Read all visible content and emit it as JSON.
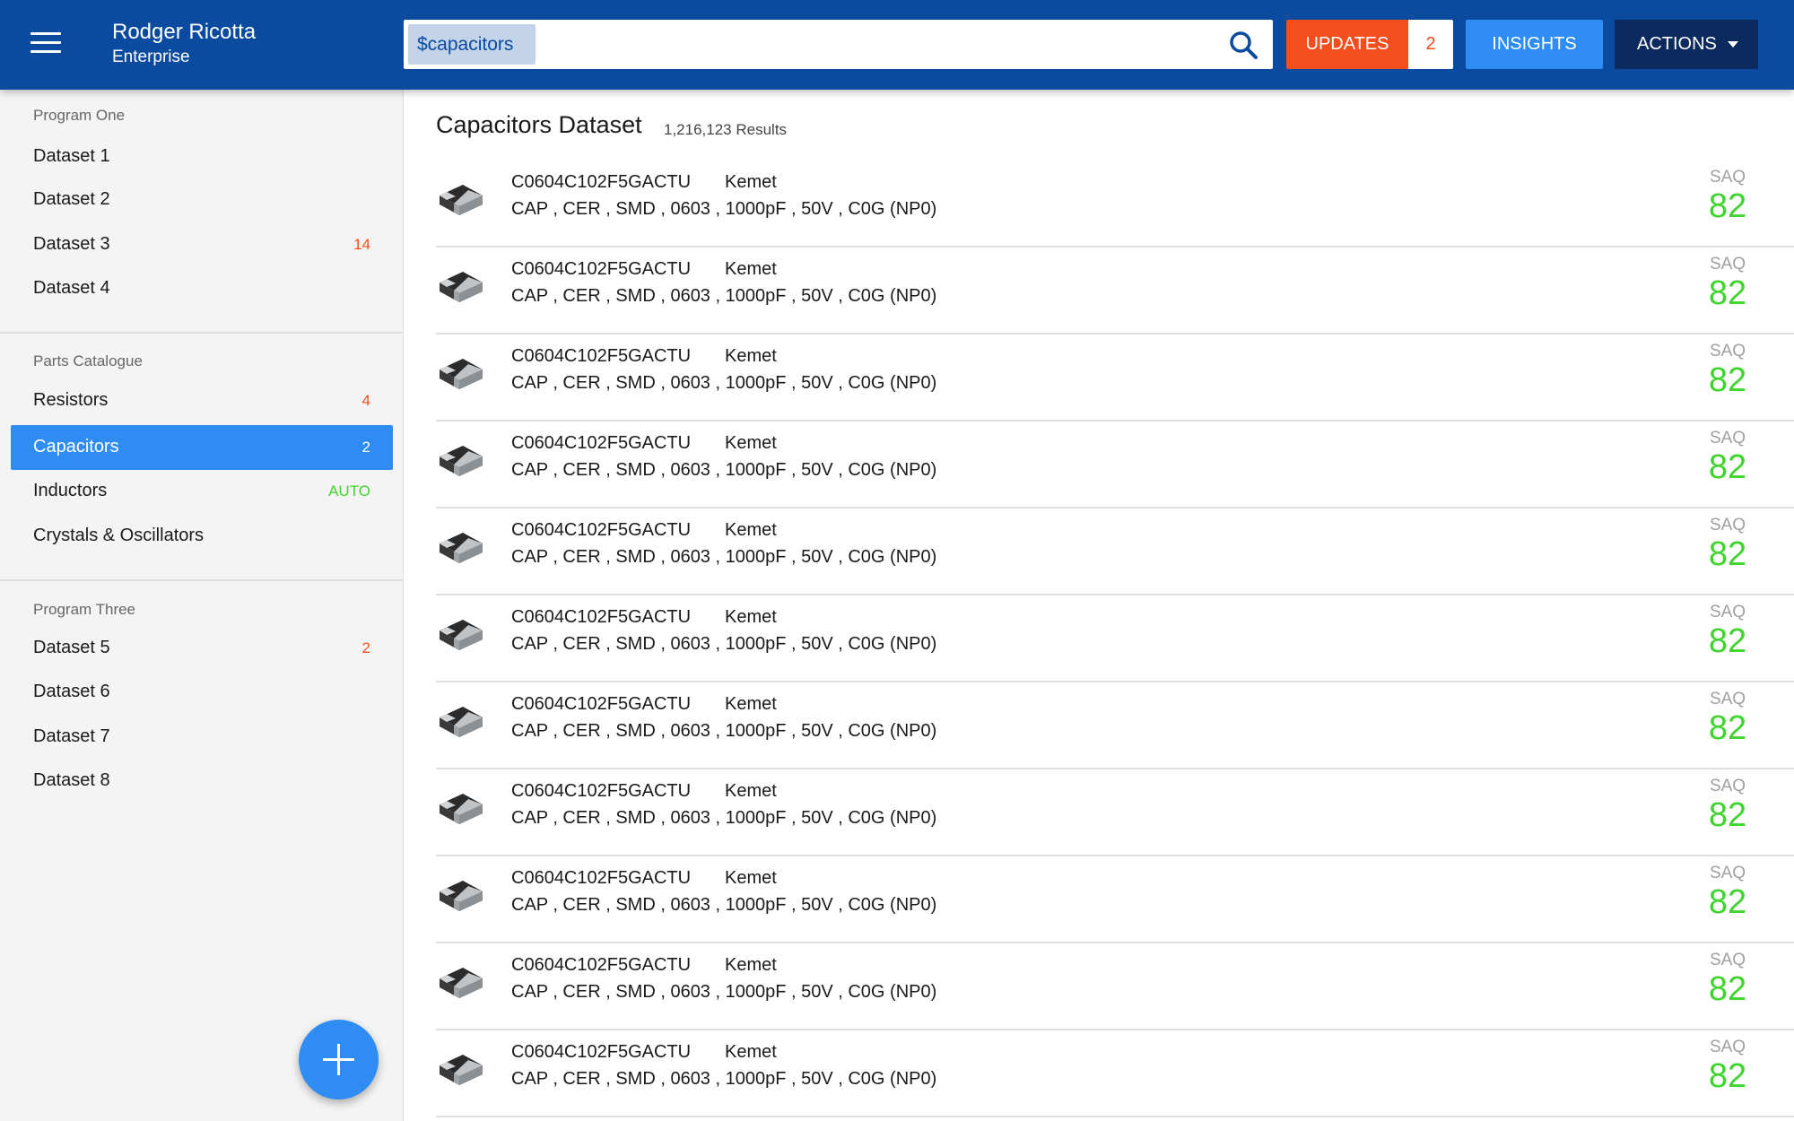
{
  "header": {
    "user_name": "Rodger Ricotta",
    "user_org": "Enterprise",
    "search": {
      "chip": "$capacitors",
      "value": "",
      "placeholder": ""
    },
    "updates_label": "UPDATES",
    "updates_count": "2",
    "insights_label": "INSIGHTS",
    "actions_label": "ACTIONS",
    "icons": {
      "menu": "hamburger-menu-icon",
      "search": "search-icon",
      "actions": "caret-down-icon"
    }
  },
  "sidebar": {
    "sections": [
      {
        "title": "Program  One",
        "items": [
          {
            "label": "Dataset 1",
            "badge": ""
          },
          {
            "label": "Dataset 2",
            "badge": ""
          },
          {
            "label": "Dataset 3",
            "badge": "14"
          },
          {
            "label": "Dataset 4",
            "badge": ""
          }
        ]
      },
      {
        "title": "Parts Catalogue",
        "items": [
          {
            "label": "Resistors",
            "badge": "4"
          },
          {
            "label": "Capacitors",
            "badge": "2",
            "active": true
          },
          {
            "label": "Inductors",
            "badge": "AUTO"
          },
          {
            "label": "Crystals & Oscillators",
            "badge": ""
          }
        ]
      },
      {
        "title": "Program  Three",
        "items": [
          {
            "label": "Dataset 5",
            "badge": "2"
          },
          {
            "label": "Dataset 6",
            "badge": ""
          },
          {
            "label": "Dataset 7",
            "badge": ""
          },
          {
            "label": "Dataset 8",
            "badge": ""
          }
        ]
      }
    ],
    "fab_icon": "plus-icon"
  },
  "main": {
    "title": "Capacitors Dataset",
    "result_count": "1,216,123 Results",
    "rows": [
      {
        "part": "C0604C102F5GACTU",
        "maker": "Kemet",
        "specs": "CAP ,  CER ,  SMD ,  0603 ,  1000pF ,  50V ,  C0G (NP0)",
        "saq_label": "SAQ",
        "saq": "82"
      },
      {
        "part": "C0604C102F5GACTU",
        "maker": "Kemet",
        "specs": "CAP ,  CER ,  SMD ,  0603 ,  1000pF ,  50V ,  C0G (NP0)",
        "saq_label": "SAQ",
        "saq": "82"
      },
      {
        "part": "C0604C102F5GACTU",
        "maker": "Kemet",
        "specs": "CAP ,  CER ,  SMD ,  0603 ,  1000pF ,  50V ,  C0G (NP0)",
        "saq_label": "SAQ",
        "saq": "82"
      },
      {
        "part": "C0604C102F5GACTU",
        "maker": "Kemet",
        "specs": "CAP ,  CER ,  SMD ,  0603 ,  1000pF ,  50V ,  C0G (NP0)",
        "saq_label": "SAQ",
        "saq": "82"
      },
      {
        "part": "C0604C102F5GACTU",
        "maker": "Kemet",
        "specs": "CAP ,  CER ,  SMD ,  0603 ,  1000pF ,  50V ,  C0G (NP0)",
        "saq_label": "SAQ",
        "saq": "82"
      },
      {
        "part": "C0604C102F5GACTU",
        "maker": "Kemet",
        "specs": "CAP ,  CER ,  SMD ,  0603 ,  1000pF ,  50V ,  C0G (NP0)",
        "saq_label": "SAQ",
        "saq": "82"
      },
      {
        "part": "C0604C102F5GACTU",
        "maker": "Kemet",
        "specs": "CAP ,  CER ,  SMD ,  0603 ,  1000pF ,  50V ,  C0G (NP0)",
        "saq_label": "SAQ",
        "saq": "82"
      },
      {
        "part": "C0604C102F5GACTU",
        "maker": "Kemet",
        "specs": "CAP ,  CER ,  SMD ,  0603 ,  1000pF ,  50V ,  C0G (NP0)",
        "saq_label": "SAQ",
        "saq": "82"
      },
      {
        "part": "C0604C102F5GACTU",
        "maker": "Kemet",
        "specs": "CAP ,  CER ,  SMD ,  0603 ,  1000pF ,  50V ,  C0G (NP0)",
        "saq_label": "SAQ",
        "saq": "82"
      },
      {
        "part": "C0604C102F5GACTU",
        "maker": "Kemet",
        "specs": "CAP ,  CER ,  SMD ,  0603 ,  1000pF ,  50V ,  C0G (NP0)",
        "saq_label": "SAQ",
        "saq": "82"
      },
      {
        "part": "C0604C102F5GACTU",
        "maker": "Kemet",
        "specs": "CAP ,  CER ,  SMD ,  0603 ,  1000pF ,  50V ,  C0G (NP0)",
        "saq_label": "SAQ",
        "saq": "82"
      }
    ],
    "row_icon": "capacitor-chip-icon"
  },
  "colors": {
    "header_bg": "#0a4a9f",
    "updates": "#f54e1e",
    "insights": "#2e8cf2",
    "actions": "#0c2a5e",
    "active_item": "#2e8cf2",
    "saq_value": "#3fd42e",
    "badge_alert": "#f54e1e",
    "badge_auto": "#3fd42e"
  }
}
